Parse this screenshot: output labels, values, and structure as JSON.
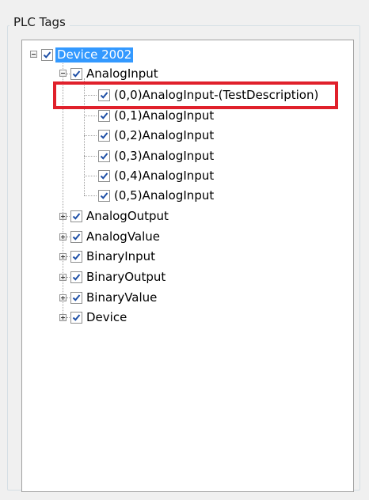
{
  "group": {
    "title": "PLC Tags"
  },
  "tree": {
    "root": {
      "label": "Device 2002",
      "checked": true,
      "expanded": true,
      "selected": true
    },
    "analog_input": {
      "label": "AnalogInput",
      "checked": true,
      "expanded": true,
      "children": [
        {
          "label": "(0,0)AnalogInput-(TestDescription)",
          "checked": true
        },
        {
          "label": "(0,1)AnalogInput",
          "checked": true
        },
        {
          "label": "(0,2)AnalogInput",
          "checked": true
        },
        {
          "label": "(0,3)AnalogInput",
          "checked": true
        },
        {
          "label": "(0,4)AnalogInput",
          "checked": true
        },
        {
          "label": "(0,5)AnalogInput",
          "checked": true
        }
      ]
    },
    "collapsed_nodes": [
      {
        "label": "AnalogOutput",
        "checked": true,
        "expanded": false
      },
      {
        "label": "AnalogValue",
        "checked": true,
        "expanded": false
      },
      {
        "label": "BinaryInput",
        "checked": true,
        "expanded": false
      },
      {
        "label": "BinaryOutput",
        "checked": true,
        "expanded": false
      },
      {
        "label": "BinaryValue",
        "checked": true,
        "expanded": false
      },
      {
        "label": "Device",
        "checked": true,
        "expanded": false
      }
    ]
  },
  "annotation": {
    "highlight_color": "#e0202b"
  },
  "colors": {
    "selection": "#3399ff",
    "check": "#1e4fa6"
  }
}
